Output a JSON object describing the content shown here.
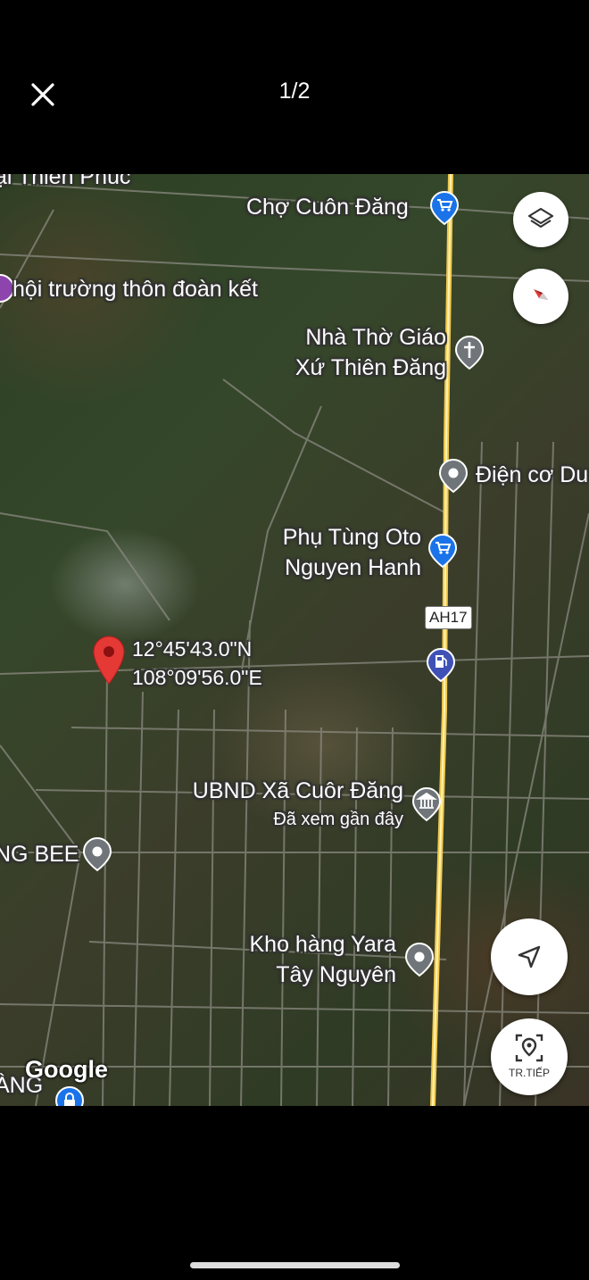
{
  "header": {
    "counter": "1/2"
  },
  "map": {
    "places": [
      {
        "name": "Chợ Cuôn Đăng",
        "icon": "shopping-cart-icon"
      },
      {
        "name": "hội trường thôn đoàn kết",
        "icon": "purple-pin-icon"
      },
      {
        "name_line1": "Nhà Thờ Giáo",
        "name_line2": "Xứ Thiên Đăng",
        "icon": "church-icon"
      },
      {
        "name": "Điện cơ Du",
        "icon": "place-pin-icon"
      },
      {
        "name_line1": "Phụ Tùng Oto",
        "name_line2": "Nguyen Hanh",
        "icon": "shopping-cart-icon"
      },
      {
        "name": "UBND Xã Cuôr Đăng",
        "subtitle": "Đã xem gần đây",
        "icon": "government-icon"
      },
      {
        "name": "NG BEE",
        "icon": "place-pin-icon"
      },
      {
        "name_line1": "Kho hàng Yara",
        "name_line2": "Tây Nguyên",
        "icon": "place-pin-icon"
      },
      {
        "name": "ại Thiên Phúc",
        "icon": "place-pin-icon"
      },
      {
        "name": "ÀNG",
        "icon": "lock-icon"
      }
    ],
    "dropped_pin": {
      "lat": "12°45'43.0\"N",
      "lng": "108°09'56.0\"E"
    },
    "road_shield": "AH17",
    "attribution": "Google",
    "next_button_label": "TR.TIẾP"
  },
  "colors": {
    "pin_red": "#e53935",
    "poi_blue": "#1a73e8",
    "poi_gray": "#70757a",
    "road_yellow": "#f2c94c"
  }
}
